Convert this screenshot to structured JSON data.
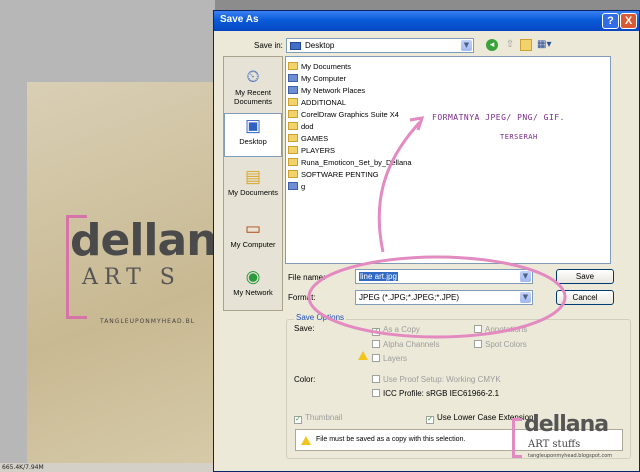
{
  "statusbar": {
    "text": "665.4K/7.94M"
  },
  "canvas": {
    "logo_main": "dellana",
    "logo_art": "ART  S",
    "logo_tagline": "TANGLEUPONMYHEAD.BL"
  },
  "dialog": {
    "title": "Save As",
    "help_label": "?",
    "close_label": "X",
    "save_in_label": "Save in:",
    "save_in_value": "Desktop",
    "places": [
      {
        "label": "My Recent Documents",
        "icon": "recent-documents-icon"
      },
      {
        "label": "Desktop",
        "icon": "desktop-icon"
      },
      {
        "label": "My Documents",
        "icon": "my-documents-icon"
      },
      {
        "label": "My Computer",
        "icon": "my-computer-icon"
      },
      {
        "label": "My Network",
        "icon": "my-network-icon"
      }
    ],
    "files": [
      {
        "name": "My Documents",
        "icon": "my-documents-icon"
      },
      {
        "name": "My Computer",
        "icon": "my-computer-icon"
      },
      {
        "name": "My Network Places",
        "icon": "network-places-icon"
      },
      {
        "name": "ADDITIONAL",
        "icon": "folder-icon"
      },
      {
        "name": "CorelDraw Graphics Suite X4",
        "icon": "folder-icon"
      },
      {
        "name": "dod",
        "icon": "folder-icon"
      },
      {
        "name": "GAMES",
        "icon": "folder-icon"
      },
      {
        "name": "PLAYERS",
        "icon": "folder-icon"
      },
      {
        "name": "Runa_Emoticon_Set_by_Dellana",
        "icon": "folder-icon"
      },
      {
        "name": "SOFTWARE PENTING",
        "icon": "folder-icon"
      },
      {
        "name": "g",
        "icon": "file-icon"
      }
    ],
    "file_name_label": "File name:",
    "file_name_value": "line art.jpg",
    "format_label": "Format:",
    "format_value": "JPEG (*.JPG;*.JPEG;*.JPE)",
    "save_button": "Save",
    "cancel_button": "Cancel",
    "save_options_title": "Save Options",
    "save_label": "Save:",
    "as_a_copy": "As a Copy",
    "annotations": "Annotations",
    "alpha_channels": "Alpha Channels",
    "spot_colors": "Spot Colors",
    "layers": "Layers",
    "color_label": "Color:",
    "use_proof_setup": "Use Proof Setup:  Working CMYK",
    "icc_profile": "ICC Profile:  sRGB IEC61966-2.1",
    "thumbnail": "Thumbnail",
    "use_lower_case": "Use Lower Case Extension",
    "warning": "File must be saved as a copy with this selection."
  },
  "annotation": {
    "line1": "FORMATNYA JPEG/ PNG/ GIF.",
    "line2": "TERSERAH"
  },
  "watermark": {
    "main": "dellana",
    "sub": "ART  stuffs",
    "tag": "tangleuponmyhead.blogspot.com"
  },
  "colors": {
    "annotation_pink": "#e38ac0",
    "titlebar_blue": "#0a5bd8",
    "dialog_bg": "#ece9d8"
  }
}
